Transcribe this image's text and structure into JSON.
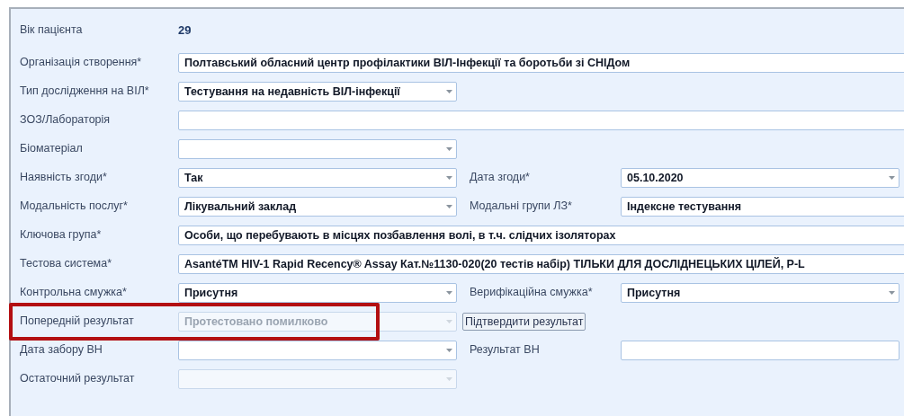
{
  "rows": [
    {
      "label": "Вік пацієнта",
      "field": {
        "kind": "text",
        "value": "29"
      }
    },
    {
      "label": "Організація створення*",
      "field": {
        "kind": "input",
        "wide": true,
        "value": "Полтавський обласний центр профілактики ВІЛ-Інфекції та боротьби зі СНІДом"
      }
    },
    {
      "label": "Тип дослідження на ВІЛ*",
      "field": {
        "kind": "combo",
        "value": "Тестування на недавність ВІЛ-інфекції",
        "disabled": false
      }
    },
    {
      "label": "ЗОЗ/Лабораторія",
      "field": {
        "kind": "input",
        "wide": true
      }
    },
    {
      "label": "Біоматеріал",
      "field": {
        "kind": "combo",
        "disabled": false
      }
    },
    {
      "label": "Наявність згоди*",
      "field": {
        "kind": "combo",
        "value": "Так",
        "disabled": false
      },
      "label2": "Дата згоди*",
      "field2": {
        "kind": "combo",
        "value": "05.10.2020",
        "disabled": false
      }
    },
    {
      "label": "Модальність послуг*",
      "field": {
        "kind": "combo",
        "value": "Лікувальний заклад",
        "disabled": false
      },
      "label2": "Модальні групи ЛЗ*",
      "field2": {
        "kind": "input",
        "wide": true,
        "value": "Індексне тестування"
      }
    },
    {
      "label": "Ключова група*",
      "field": {
        "kind": "input",
        "wide": true,
        "value": "Особи, що перебувають в місцях позбавлення волі, в т.ч. слідчих ізоляторах"
      }
    },
    {
      "label": "Тестова система*",
      "field": {
        "kind": "input",
        "wide": true,
        "value": "AsantéTM HIV-1 Rapid Recency® Assay Кат.№1130-020(20 тестів набір) ТІЛЬКИ ДЛЯ ДОСЛІДНЕЦЬКИХ ЦІЛЕЙ, P-L"
      }
    },
    {
      "label": "Контрольна смужка*",
      "field": {
        "kind": "combo",
        "value": "Присутня",
        "disabled": false
      },
      "label2": "Верифікаційна смужка*",
      "field2": {
        "kind": "combo",
        "value": "Присутня",
        "disabled": false
      }
    },
    {
      "label": "Попередній результат",
      "highlighted": true,
      "field": {
        "kind": "combo",
        "value": "Протестовано помилково",
        "disabled": true
      },
      "button": "Підтвердити результат"
    },
    {
      "label": "Дата забору ВН",
      "field": {
        "kind": "combo",
        "disabled": false
      },
      "label2": "Результат ВН",
      "field2": {
        "kind": "input",
        "wide": false
      }
    },
    {
      "label": "Остаточний результат",
      "field": {
        "kind": "combo",
        "disabled": true
      }
    }
  ]
}
